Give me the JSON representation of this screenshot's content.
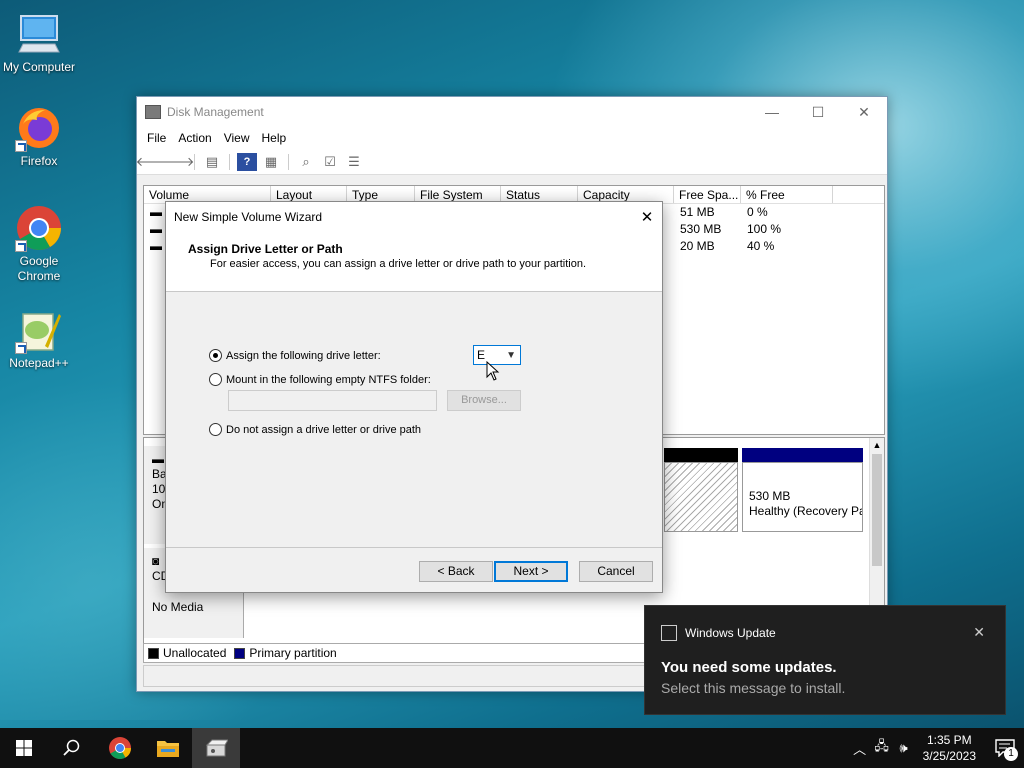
{
  "desktop": {
    "icons": [
      {
        "label": "My Computer",
        "icon": "computer-icon"
      },
      {
        "label": "Firefox",
        "icon": "firefox-icon"
      },
      {
        "label": "Google Chrome",
        "icon": "chrome-icon"
      },
      {
        "label": "Notepad++",
        "icon": "notepad-plus-plus-icon"
      }
    ]
  },
  "disk_management": {
    "title": "Disk Management",
    "menu": [
      "File",
      "Action",
      "View",
      "Help"
    ],
    "columns": [
      "Volume",
      "Layout",
      "Type",
      "File System",
      "Status",
      "Capacity",
      "Free Spa...",
      "% Free"
    ],
    "rows": [
      {
        "free": "51 MB",
        "pct": "0 %"
      },
      {
        "free": "530 MB",
        "pct": "100 %"
      },
      {
        "free": "20 MB",
        "pct": "40 %"
      }
    ],
    "disk0_label_lines": [
      "Ba",
      "10",
      "On"
    ],
    "cd_label_lines": [
      "CD",
      "No Media"
    ],
    "recovery_size": "530 MB",
    "recovery_status": "Healthy (Recovery Pa",
    "legend": [
      "Unallocated",
      "Primary partition"
    ],
    "colors": {
      "unallocated": "#000000",
      "primary": "#000080"
    }
  },
  "wizard": {
    "title": "New Simple Volume Wizard",
    "close": "✕",
    "heading": "Assign Drive Letter or Path",
    "subheading": "For easier access, you can assign a drive letter or drive path to your partition.",
    "opt_assign": "Assign the following drive letter:",
    "opt_mount": "Mount in the following empty NTFS folder:",
    "opt_none": "Do not assign a drive letter or drive path",
    "drive_letter": "E",
    "browse": "Browse...",
    "back": "< Back",
    "next": "Next >",
    "cancel": "Cancel",
    "selected_option": "assign"
  },
  "toast": {
    "app": "Windows Update",
    "title": "You need some updates.",
    "body": "Select this message to install.",
    "close": "✕"
  },
  "taskbar": {
    "time": "1:35 PM",
    "date": "3/25/2023",
    "notification_count": "1"
  }
}
